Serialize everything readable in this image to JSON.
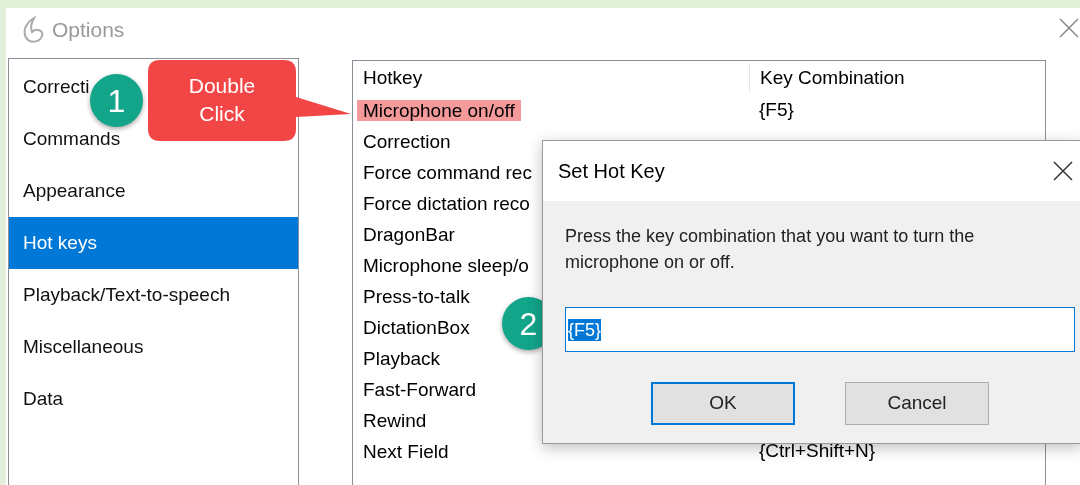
{
  "window": {
    "title": "Options"
  },
  "sidebar": {
    "items": [
      {
        "label": "Correcti",
        "selected": false
      },
      {
        "label": "Commands",
        "selected": false
      },
      {
        "label": "Appearance",
        "selected": false
      },
      {
        "label": "Hot keys",
        "selected": true
      },
      {
        "label": "Playback/Text-to-speech",
        "selected": false
      },
      {
        "label": "Miscellaneous",
        "selected": false
      },
      {
        "label": "Data",
        "selected": false
      }
    ]
  },
  "table": {
    "columns": [
      "Hotkey",
      "Key Combination"
    ],
    "rows": [
      {
        "hotkey": "Microphone on/off",
        "keys": "{F5}",
        "highlighted": true
      },
      {
        "hotkey": "Correction",
        "highlighted": false
      },
      {
        "hotkey": "Force command rec",
        "highlighted": false
      },
      {
        "hotkey": "Force dictation reco",
        "highlighted": false
      },
      {
        "hotkey": "DragonBar",
        "highlighted": false
      },
      {
        "hotkey": "Microphone sleep/o",
        "highlighted": false
      },
      {
        "hotkey": "Press-to-talk",
        "highlighted": false
      },
      {
        "hotkey": "DictationBox",
        "highlighted": false
      },
      {
        "hotkey": "Playback",
        "highlighted": false
      },
      {
        "hotkey": "Fast-Forward",
        "highlighted": false
      },
      {
        "hotkey": "Rewind",
        "highlighted": false
      },
      {
        "hotkey": "Next Field",
        "keys": "{Ctrl+Shift+N}",
        "highlighted": false
      }
    ]
  },
  "dialog": {
    "title": "Set Hot Key",
    "message": "Press the key combination that you want to turn the microphone on or off.",
    "value": "{F5}",
    "buttons": [
      {
        "label": "OK",
        "default": true
      },
      {
        "label": "Cancel",
        "default": false
      }
    ]
  },
  "annotations": [
    {
      "kind": "badge",
      "text": "1"
    },
    {
      "kind": "callout",
      "text": "Double\nClick"
    },
    {
      "kind": "badge",
      "text": "2"
    }
  ]
}
